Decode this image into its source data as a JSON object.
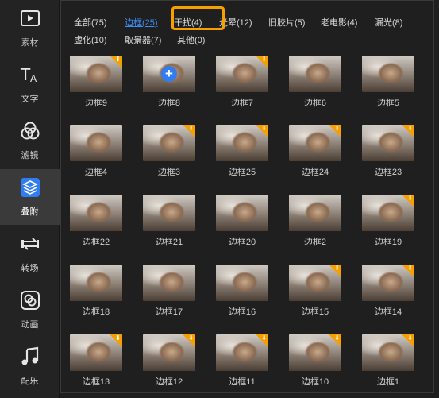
{
  "sidebar": {
    "items": [
      {
        "label": "素材",
        "icon": "media-icon"
      },
      {
        "label": "文字",
        "icon": "text-icon"
      },
      {
        "label": "滤镜",
        "icon": "filter-icon"
      },
      {
        "label": "叠附",
        "icon": "overlay-icon",
        "active": true
      },
      {
        "label": "转场",
        "icon": "transition-icon"
      },
      {
        "label": "动画",
        "icon": "animation-icon"
      },
      {
        "label": "配乐",
        "icon": "music-icon"
      }
    ]
  },
  "tabs": [
    {
      "label": "全部(75)"
    },
    {
      "label": "边框(25)",
      "active": true
    },
    {
      "label": "干扰(4)"
    },
    {
      "label": "光晕(12)"
    },
    {
      "label": "旧胶片(5)"
    },
    {
      "label": "老电影(4)"
    },
    {
      "label": "漏光(8)"
    },
    {
      "label": "虚化(10)"
    },
    {
      "label": "取景器(7)"
    },
    {
      "label": "其他(0)"
    }
  ],
  "items": [
    {
      "name": "边框9"
    },
    {
      "name": "边框8"
    },
    {
      "name": "边框7"
    },
    {
      "name": "边框6"
    },
    {
      "name": "边框5"
    },
    {
      "name": "边框4"
    },
    {
      "name": "边框3"
    },
    {
      "name": "边框25"
    },
    {
      "name": "边框24"
    },
    {
      "name": "边框23"
    },
    {
      "name": "边框22"
    },
    {
      "name": "边框21"
    },
    {
      "name": "边框20"
    },
    {
      "name": "边框2"
    },
    {
      "name": "边框19"
    },
    {
      "name": "边框18"
    },
    {
      "name": "边框17"
    },
    {
      "name": "边框16"
    },
    {
      "name": "边框15"
    },
    {
      "name": "边框14"
    },
    {
      "name": "边框13"
    },
    {
      "name": "边框12"
    },
    {
      "name": "边框11"
    },
    {
      "name": "边框10"
    },
    {
      "name": "边框1"
    }
  ],
  "colors": {
    "accent": "#3d8ef5",
    "highlight": "#f5a000",
    "download_badge": "#f5a000",
    "add_button": "#2f7df0"
  }
}
